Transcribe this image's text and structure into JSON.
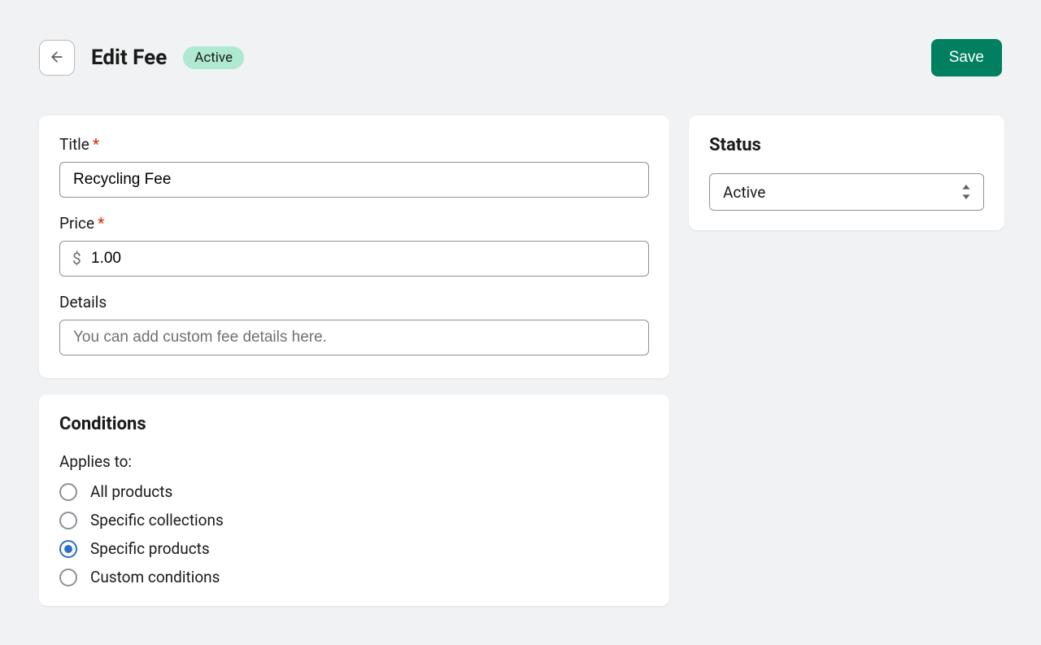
{
  "header": {
    "page_title": "Edit Fee",
    "badge": "Active",
    "save_label": "Save"
  },
  "form": {
    "title": {
      "label": "Title",
      "required": true,
      "value": "Recycling Fee"
    },
    "price": {
      "label": "Price",
      "required": true,
      "prefix": "$",
      "value": "1.00"
    },
    "details": {
      "label": "Details",
      "placeholder": "You can add custom fee details here."
    }
  },
  "conditions": {
    "title": "Conditions",
    "applies_label": "Applies to:",
    "options": [
      {
        "label": "All products",
        "selected": false
      },
      {
        "label": "Specific collections",
        "selected": false
      },
      {
        "label": "Specific products",
        "selected": true
      },
      {
        "label": "Custom conditions",
        "selected": false
      }
    ]
  },
  "status": {
    "title": "Status",
    "value": "Active"
  }
}
